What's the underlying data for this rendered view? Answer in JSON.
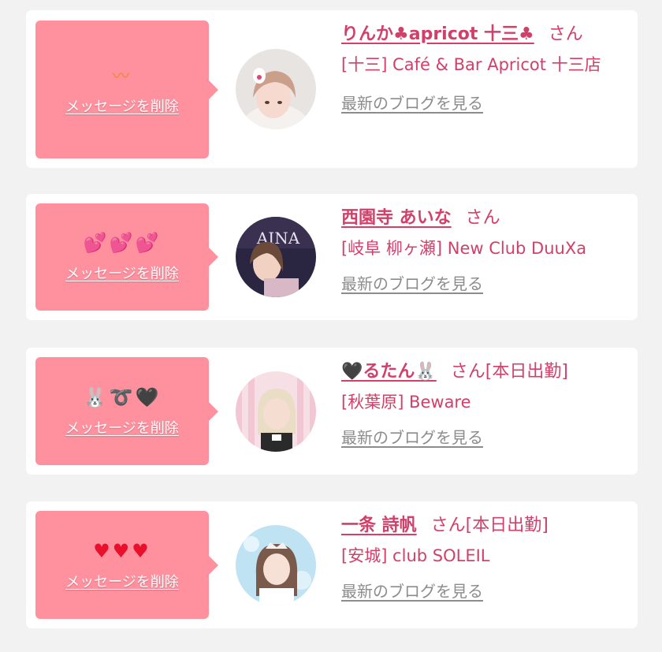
{
  "colors": {
    "bubble": "#ff919f",
    "accent_text": "#d2406a",
    "muted_link": "#8c8c8c",
    "card_bg": "#ffffff",
    "page_bg": "#f2f2f2"
  },
  "entries": [
    {
      "emoji": "〰",
      "emoji_icon": "orange-squiggle-icon",
      "delete_label": "メッセージを削除",
      "name": "りんか♣apricot 十三♣",
      "honorific": "さん",
      "shop": "[十三] Café & Bar Apricot 十三店",
      "blog_label": "最新のブログを見る",
      "avatar_icon": "profile-photo-rinka"
    },
    {
      "emoji": "💕💕💕",
      "emoji_icon": "pink-hearts-icon",
      "delete_label": "メッセージを削除",
      "name": "西園寺 あいな",
      "honorific": "さん",
      "shop": "[岐阜 柳ヶ瀬] New Club DuuXa",
      "blog_label": "最新のブログを見る",
      "avatar_icon": "profile-photo-aina"
    },
    {
      "emoji": "🐰➰🖤",
      "emoji_icon": "rabbit-loop-heart-icon",
      "delete_label": "メッセージを削除",
      "name": "🖤るたん🐰",
      "honorific": "さん[本日出勤]",
      "shop": "[秋葉原] Beware",
      "blog_label": "最新のブログを見る",
      "avatar_icon": "profile-photo-rutan"
    },
    {
      "emoji": "♥♥♥",
      "emoji_icon": "red-hearts-icon",
      "delete_label": "メッセージを削除",
      "name": "一条 詩帆",
      "honorific": "さん[本日出勤]",
      "shop": "[安城] club SOLEIL",
      "blog_label": "最新のブログを見る",
      "avatar_icon": "profile-photo-shiho"
    }
  ]
}
